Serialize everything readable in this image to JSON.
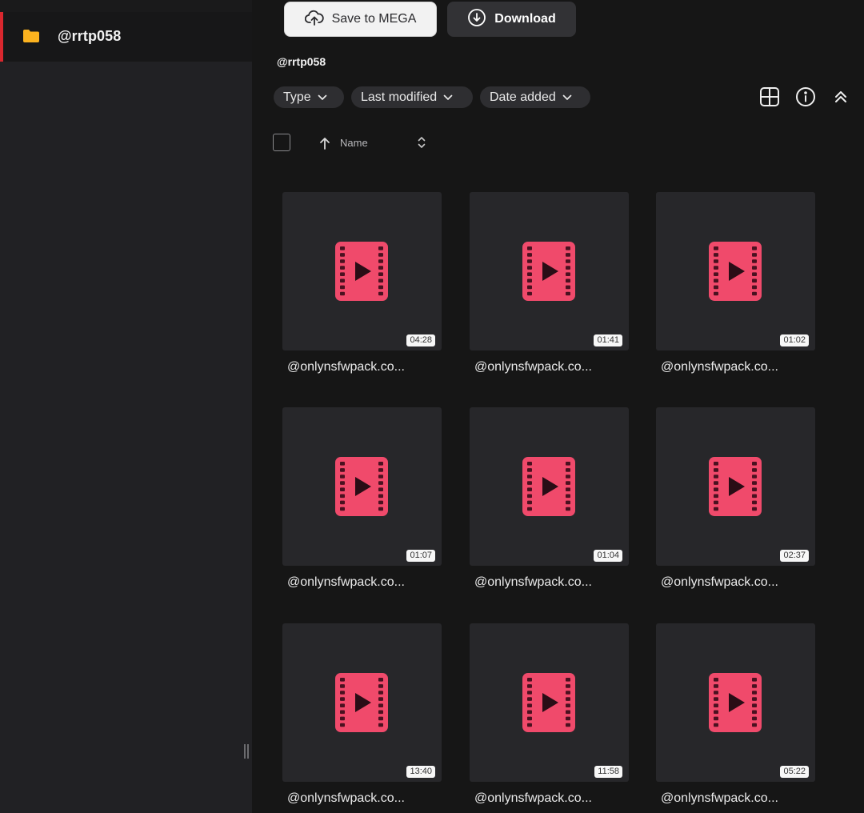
{
  "sidebar": {
    "items": [
      {
        "label": "@rrtp058",
        "icon": "folder-icon",
        "active": true
      }
    ]
  },
  "toolbar": {
    "save_label": "Save to MEGA",
    "download_label": "Download"
  },
  "folder_title": "@rrtp058",
  "filters": {
    "type_label": "Type",
    "last_modified_label": "Last modified",
    "date_added_label": "Date added"
  },
  "list_header": {
    "name_label": "Name"
  },
  "colors": {
    "accent": "#d9272e",
    "folder": "#fbb21f",
    "video_icon": "#f04a6b"
  },
  "files": [
    {
      "name": "@onlynsfwpack.co...",
      "duration": "04:28"
    },
    {
      "name": "@onlynsfwpack.co...",
      "duration": "01:41"
    },
    {
      "name": "@onlynsfwpack.co...",
      "duration": "01:02"
    },
    {
      "name": "@onlynsfwpack.co...",
      "duration": "01:07"
    },
    {
      "name": "@onlynsfwpack.co...",
      "duration": "01:04"
    },
    {
      "name": "@onlynsfwpack.co...",
      "duration": "02:37"
    },
    {
      "name": "@onlynsfwpack.co...",
      "duration": "13:40"
    },
    {
      "name": "@onlynsfwpack.co...",
      "duration": "11:58"
    },
    {
      "name": "@onlynsfwpack.co...",
      "duration": "05:22"
    }
  ]
}
